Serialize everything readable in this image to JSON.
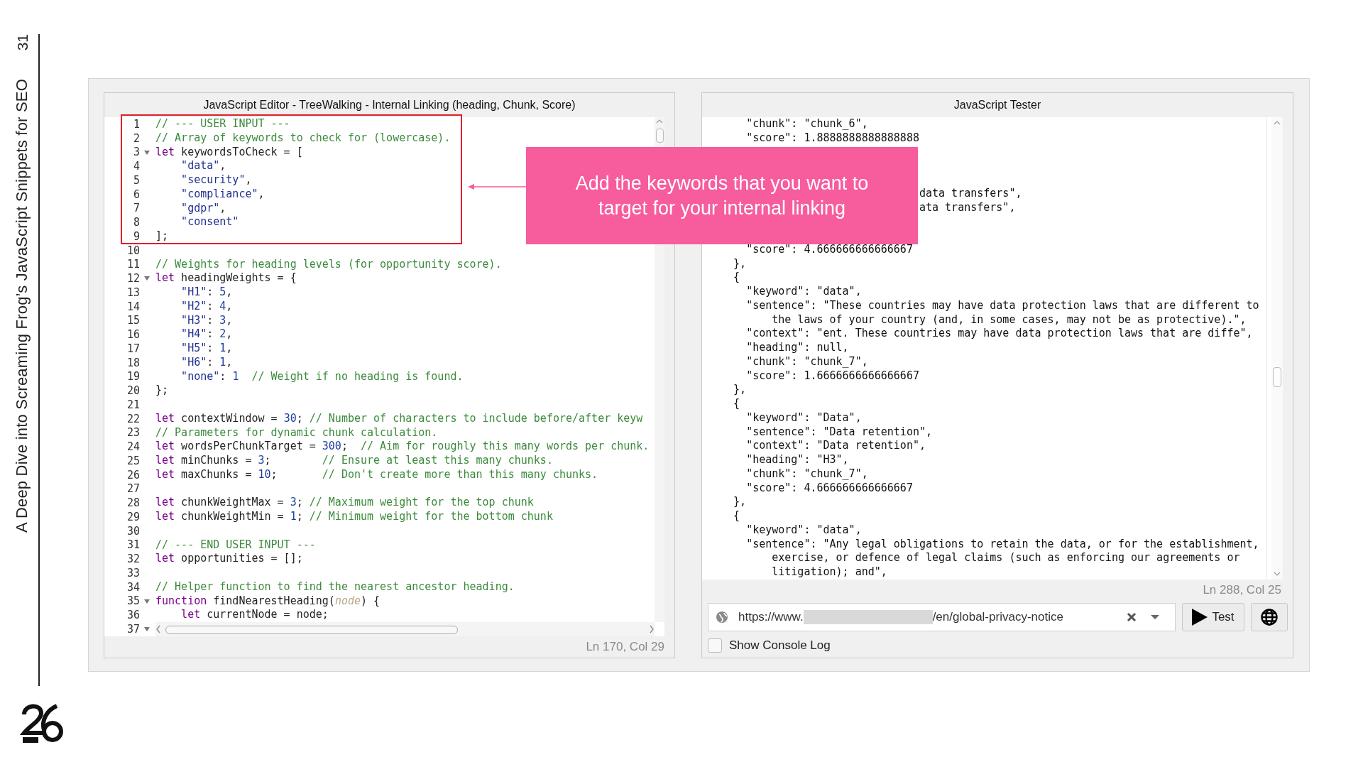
{
  "slide": {
    "page_number": "31",
    "title": "A Deep Dive into Screaming Frog’s JavaScript Snippets for SEO"
  },
  "editor": {
    "title": "JavaScript Editor - TreeWalking - Internal Linking (heading, Chunk, Score)",
    "status": "Ln 170, Col 29",
    "lines": [
      {
        "number": "1",
        "foldable": false,
        "tokens": [
          {
            "kind": "comment",
            "text": "// --- USER INPUT ---"
          }
        ]
      },
      {
        "number": "2",
        "foldable": false,
        "tokens": [
          {
            "kind": "comment",
            "text": "// Array of keywords to check for (lowercase)."
          }
        ]
      },
      {
        "number": "3",
        "foldable": true,
        "tokens": [
          {
            "kind": "keyword",
            "text": "let"
          },
          {
            "kind": "plain",
            "text": " keywordsToCheck = ["
          }
        ]
      },
      {
        "number": "4",
        "foldable": false,
        "tokens": [
          {
            "kind": "string",
            "text": "    \"data\""
          },
          {
            "kind": "plain",
            "text": ","
          }
        ]
      },
      {
        "number": "5",
        "foldable": false,
        "tokens": [
          {
            "kind": "string",
            "text": "    \"security\""
          },
          {
            "kind": "plain",
            "text": ","
          }
        ]
      },
      {
        "number": "6",
        "foldable": false,
        "tokens": [
          {
            "kind": "string",
            "text": "    \"compliance\""
          },
          {
            "kind": "plain",
            "text": ","
          }
        ]
      },
      {
        "number": "7",
        "foldable": false,
        "tokens": [
          {
            "kind": "string",
            "text": "    \"gdpr\""
          },
          {
            "kind": "plain",
            "text": ","
          }
        ]
      },
      {
        "number": "8",
        "foldable": false,
        "tokens": [
          {
            "kind": "string",
            "text": "    \"consent\""
          }
        ]
      },
      {
        "number": "9",
        "foldable": false,
        "tokens": [
          {
            "kind": "plain",
            "text": "];"
          }
        ]
      },
      {
        "number": "10",
        "foldable": false
      },
      {
        "number": "11",
        "foldable": false,
        "tokens": [
          {
            "kind": "comment",
            "text": "// Weights for heading levels (for opportunity score)."
          }
        ]
      },
      {
        "number": "12",
        "foldable": true,
        "tokens": [
          {
            "kind": "keyword",
            "text": "let"
          },
          {
            "kind": "plain",
            "text": " headingWeights = {"
          }
        ]
      },
      {
        "number": "13",
        "foldable": false,
        "tokens": [
          {
            "kind": "string",
            "text": "    \"H1\""
          },
          {
            "kind": "plain",
            "text": ": "
          },
          {
            "kind": "number",
            "text": "5"
          },
          {
            "kind": "plain",
            "text": ","
          }
        ]
      },
      {
        "number": "14",
        "foldable": false,
        "tokens": [
          {
            "kind": "string",
            "text": "    \"H2\""
          },
          {
            "kind": "plain",
            "text": ": "
          },
          {
            "kind": "number",
            "text": "4"
          },
          {
            "kind": "plain",
            "text": ","
          }
        ]
      },
      {
        "number": "15",
        "foldable": false,
        "tokens": [
          {
            "kind": "string",
            "text": "    \"H3\""
          },
          {
            "kind": "plain",
            "text": ": "
          },
          {
            "kind": "number",
            "text": "3"
          },
          {
            "kind": "plain",
            "text": ","
          }
        ]
      },
      {
        "number": "16",
        "foldable": false,
        "tokens": [
          {
            "kind": "string",
            "text": "    \"H4\""
          },
          {
            "kind": "plain",
            "text": ": "
          },
          {
            "kind": "number",
            "text": "2"
          },
          {
            "kind": "plain",
            "text": ","
          }
        ]
      },
      {
        "number": "17",
        "foldable": false,
        "tokens": [
          {
            "kind": "string",
            "text": "    \"H5\""
          },
          {
            "kind": "plain",
            "text": ": "
          },
          {
            "kind": "number",
            "text": "1"
          },
          {
            "kind": "plain",
            "text": ","
          }
        ]
      },
      {
        "number": "18",
        "foldable": false,
        "tokens": [
          {
            "kind": "string",
            "text": "    \"H6\""
          },
          {
            "kind": "plain",
            "text": ": "
          },
          {
            "kind": "number",
            "text": "1"
          },
          {
            "kind": "plain",
            "text": ","
          }
        ]
      },
      {
        "number": "19",
        "foldable": false,
        "tokens": [
          {
            "kind": "string",
            "text": "    \"none\""
          },
          {
            "kind": "plain",
            "text": ": "
          },
          {
            "kind": "number",
            "text": "1"
          },
          {
            "kind": "comment",
            "text": "  // Weight if no heading is found."
          }
        ]
      },
      {
        "number": "20",
        "foldable": false,
        "tokens": [
          {
            "kind": "plain",
            "text": "};"
          }
        ]
      },
      {
        "number": "21",
        "foldable": false
      },
      {
        "number": "22",
        "foldable": false,
        "tokens": [
          {
            "kind": "keyword",
            "text": "let"
          },
          {
            "kind": "plain",
            "text": " contextWindow = "
          },
          {
            "kind": "number",
            "text": "30"
          },
          {
            "kind": "plain",
            "text": "; "
          },
          {
            "kind": "comment",
            "text": "// Number of characters to include before/after keyw"
          }
        ]
      },
      {
        "number": "23",
        "foldable": false,
        "tokens": [
          {
            "kind": "comment",
            "text": "// Parameters for dynamic chunk calculation."
          }
        ]
      },
      {
        "number": "24",
        "foldable": false,
        "tokens": [
          {
            "kind": "keyword",
            "text": "let"
          },
          {
            "kind": "plain",
            "text": " wordsPerChunkTarget = "
          },
          {
            "kind": "number",
            "text": "300"
          },
          {
            "kind": "plain",
            "text": ";  "
          },
          {
            "kind": "comment",
            "text": "// Aim for roughly this many words per chunk."
          }
        ]
      },
      {
        "number": "25",
        "foldable": false,
        "tokens": [
          {
            "kind": "keyword",
            "text": "let"
          },
          {
            "kind": "plain",
            "text": " minChunks = "
          },
          {
            "kind": "number",
            "text": "3"
          },
          {
            "kind": "plain",
            "text": ";        "
          },
          {
            "kind": "comment",
            "text": "// Ensure at least this many chunks."
          }
        ]
      },
      {
        "number": "26",
        "foldable": false,
        "tokens": [
          {
            "kind": "keyword",
            "text": "let"
          },
          {
            "kind": "plain",
            "text": " maxChunks = "
          },
          {
            "kind": "number",
            "text": "10"
          },
          {
            "kind": "plain",
            "text": ";       "
          },
          {
            "kind": "comment",
            "text": "// Don't create more than this many chunks."
          }
        ]
      },
      {
        "number": "27",
        "foldable": false
      },
      {
        "number": "28",
        "foldable": false,
        "tokens": [
          {
            "kind": "keyword",
            "text": "let"
          },
          {
            "kind": "plain",
            "text": " chunkWeightMax = "
          },
          {
            "kind": "number",
            "text": "3"
          },
          {
            "kind": "plain",
            "text": "; "
          },
          {
            "kind": "comment",
            "text": "// Maximum weight for the top chunk"
          }
        ]
      },
      {
        "number": "29",
        "foldable": false,
        "tokens": [
          {
            "kind": "keyword",
            "text": "let"
          },
          {
            "kind": "plain",
            "text": " chunkWeightMin = "
          },
          {
            "kind": "number",
            "text": "1"
          },
          {
            "kind": "plain",
            "text": "; "
          },
          {
            "kind": "comment",
            "text": "// Minimum weight for the bottom chunk"
          }
        ]
      },
      {
        "number": "30",
        "foldable": false
      },
      {
        "number": "31",
        "foldable": false,
        "tokens": [
          {
            "kind": "comment",
            "text": "// --- END USER INPUT ---"
          }
        ]
      },
      {
        "number": "32",
        "foldable": false,
        "tokens": [
          {
            "kind": "keyword",
            "text": "let"
          },
          {
            "kind": "plain",
            "text": " opportunities = [];"
          }
        ]
      },
      {
        "number": "33",
        "foldable": false
      },
      {
        "number": "34",
        "foldable": false,
        "tokens": [
          {
            "kind": "comment",
            "text": "// Helper function to find the nearest ancestor heading."
          }
        ]
      },
      {
        "number": "35",
        "foldable": true,
        "tokens": [
          {
            "kind": "keyword",
            "text": "function"
          },
          {
            "kind": "plain",
            "text": " findNearestHeading("
          },
          {
            "kind": "param",
            "text": "node"
          },
          {
            "kind": "plain",
            "text": ") {"
          }
        ]
      },
      {
        "number": "36",
        "foldable": false,
        "tokens": [
          {
            "kind": "keyword",
            "text": "    let"
          },
          {
            "kind": "plain",
            "text": " currentNode = node;"
          }
        ]
      },
      {
        "number": "37",
        "foldable": true
      }
    ]
  },
  "tester": {
    "title": "JavaScript Tester",
    "status": "Ln 288, Col 25",
    "output_lines": [
      {
        "covered": false,
        "text": "    \"chunk\": \"chunk_6\","
      },
      {
        "covered": false,
        "text": "    \"score\": 1.8888888888888888"
      },
      {
        "covered": true
      },
      {
        "covered": true
      },
      {
        "covered": true
      },
      {
        "covered": false,
        "text": "                               data transfers\","
      },
      {
        "covered": false,
        "text": "                               ata transfers\","
      },
      {
        "covered": true
      },
      {
        "covered": true
      },
      {
        "covered": false,
        "text": "    \"score\": 4.666666666666667"
      },
      {
        "covered": false,
        "text": "  },"
      },
      {
        "covered": false,
        "text": "  {"
      },
      {
        "covered": false,
        "text": "    \"keyword\": \"data\","
      },
      {
        "covered": false,
        "text": "    \"sentence\": \"These countries may have data protection laws that are different to"
      },
      {
        "covered": false,
        "text": "        the laws of your country (and, in some cases, may not be as protective).\","
      },
      {
        "covered": false,
        "text": "    \"context\": \"ent. These countries may have data protection laws that are diffe\","
      },
      {
        "covered": false,
        "text": "    \"heading\": null,"
      },
      {
        "covered": false,
        "text": "    \"chunk\": \"chunk_7\","
      },
      {
        "covered": false,
        "text": "    \"score\": 1.6666666666666667"
      },
      {
        "covered": false,
        "text": "  },"
      },
      {
        "covered": false,
        "text": "  {"
      },
      {
        "covered": false,
        "text": "    \"keyword\": \"Data\","
      },
      {
        "covered": false,
        "text": "    \"sentence\": \"Data retention\","
      },
      {
        "covered": false,
        "text": "    \"context\": \"Data retention\","
      },
      {
        "covered": false,
        "text": "    \"heading\": \"H3\","
      },
      {
        "covered": false,
        "text": "    \"chunk\": \"chunk_7\","
      },
      {
        "covered": false,
        "text": "    \"score\": 4.666666666666667"
      },
      {
        "covered": false,
        "text": "  },"
      },
      {
        "covered": false,
        "text": "  {"
      },
      {
        "covered": false,
        "text": "    \"keyword\": \"data\","
      },
      {
        "covered": false,
        "text": "    \"sentence\": \"Any legal obligations to retain the data, or for the establishment,"
      },
      {
        "covered": false,
        "text": "        exercise, or defence of legal claims (such as enforcing our agreements or"
      },
      {
        "covered": false,
        "text": "        litigation); and\","
      }
    ],
    "url": {
      "prefix": "https://www.",
      "redacted": true,
      "suffix": "/en/global-privacy-notice"
    },
    "test_button": "Test",
    "console_log": {
      "label": "Show Console Log",
      "checked": false
    }
  },
  "callout": {
    "text": "Add the keywords that you want to target for your internal linking"
  }
}
